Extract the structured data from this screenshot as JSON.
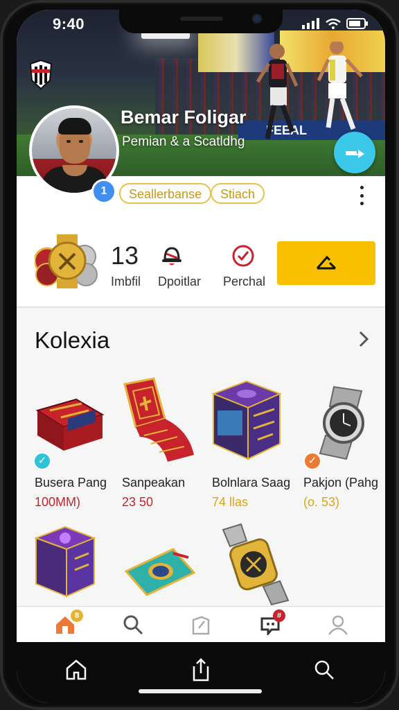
{
  "status_bar": {
    "time": "9:40"
  },
  "profile": {
    "name": "Bemar Foligar",
    "subtitle": "Pemian & a Scatldhg",
    "verified_label": "1",
    "tags": [
      "Seallerbanse",
      "Stiach"
    ],
    "hero_ad_text": "FEEAL"
  },
  "stats": {
    "count_value": "13",
    "count_label": "Imbfil",
    "item2_label": "Dpoitlar",
    "item3_label": "Perchal",
    "action_icon": "share-arrow-icon"
  },
  "collection": {
    "title": "Kolexia",
    "items": [
      {
        "name": "Busera Pang",
        "price": "100MM)",
        "price_color": "#c8232c",
        "check_color": "#2fc3d6"
      },
      {
        "name": "Sanpeakan",
        "price": "23 50",
        "price_color": "#c8232c"
      },
      {
        "name": "Bolnlara Saag",
        "price": "74 llas",
        "price_color": "#d9a514"
      },
      {
        "name": "Pakjon (Pahg",
        "price": "(o. 53)",
        "price_color": "#d9a514",
        "check_color": "#ec7a35"
      }
    ]
  },
  "bottom_nav": {
    "items": [
      "home-icon",
      "search-icon",
      "box-icon",
      "tag-icon",
      "profile-icon"
    ],
    "home_badge": "8",
    "tag_badge": "#"
  },
  "colors": {
    "accent": "#f9c000",
    "share": "#3cc8e8",
    "verify": "#3f8ef0"
  }
}
